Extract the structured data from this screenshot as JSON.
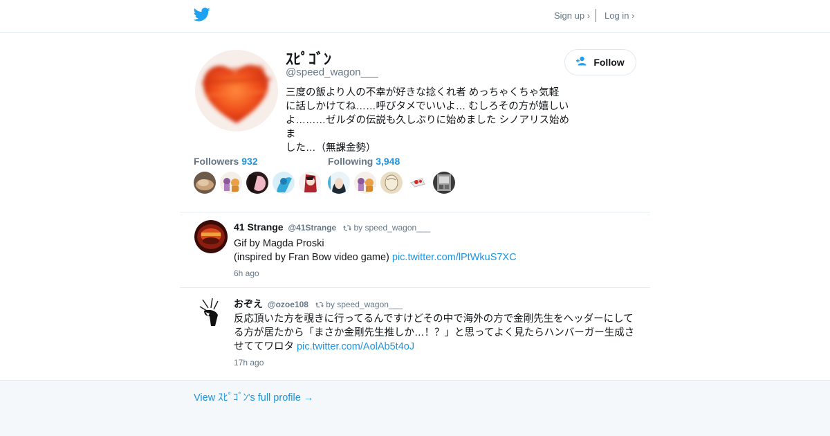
{
  "header": {
    "logo_icon": "twitter-bird-icon",
    "signup_label": "Sign up ›",
    "login_label": "Log in ›",
    "brand_color": "#1da1f2"
  },
  "profile": {
    "display_name": "ｽﾋﾟｺﾞﾝ",
    "screen_name": "@speed_wagon___",
    "bio_lines": [
      "三度の飯より人の不幸が好きな捻くれ者 めっちゃくちゃ気軽",
      "に話しかけてね……呼びタメでいいよ… むしろその方が嬉しい",
      "よ………ゼルダの伝説も久しぶりに始めました シノアリス始めま",
      "した…（無課金勢）"
    ],
    "follow_label": "Follow",
    "follow_icon": "add-user-icon"
  },
  "stats": {
    "followers_label": "Followers",
    "followers_count": "932",
    "following_label": "Following",
    "following_count": "3,948"
  },
  "tweets": [
    {
      "name": "41 Strange",
      "handle": "@41Strange",
      "retweet_icon": "retweet-icon",
      "retweeted_by": "by speed_wagon___",
      "text_line1": "Gif by Magda Proski",
      "text_line2": "(inspired by Fran Bow video game) ",
      "link": "pic.twitter.com/lPtWkuS7XC",
      "time": "6h ago"
    },
    {
      "name": "おぞえ",
      "handle": "@ozoe108",
      "retweet_icon": "retweet-icon",
      "retweeted_by": "by speed_wagon___",
      "text": "反応頂いた方を覗きに行ってるんですけどその中で海外の方で金剛先生をヘッダーにしてる方が居たから「まさか金剛先生推しか…！？」と思ってよく見たらハンバーガー生成させててワロタ ",
      "link": "pic.twitter.com/AolAb5t4oJ",
      "time": "17h ago"
    }
  ],
  "footer": {
    "full_profile_label": "View ｽﾋﾟｺﾞﾝ's full profile →"
  }
}
